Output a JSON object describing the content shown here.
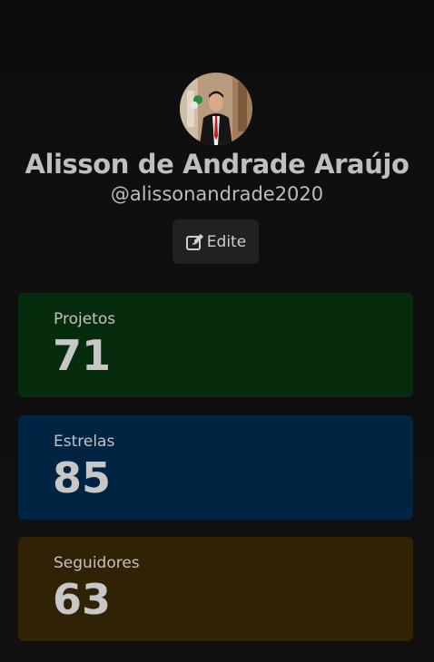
{
  "profile": {
    "name": "Alisson de Andrade Araújo",
    "username": "@alissonandrade2020",
    "edit_label": "Edite",
    "edit_icon": "edit-icon"
  },
  "stats": [
    {
      "label": "Projetos",
      "value": "71",
      "color": "#062c0d"
    },
    {
      "label": "Estrelas",
      "value": "85",
      "color": "#012442"
    },
    {
      "label": "Seguidores",
      "value": "63",
      "color": "#302205"
    }
  ]
}
